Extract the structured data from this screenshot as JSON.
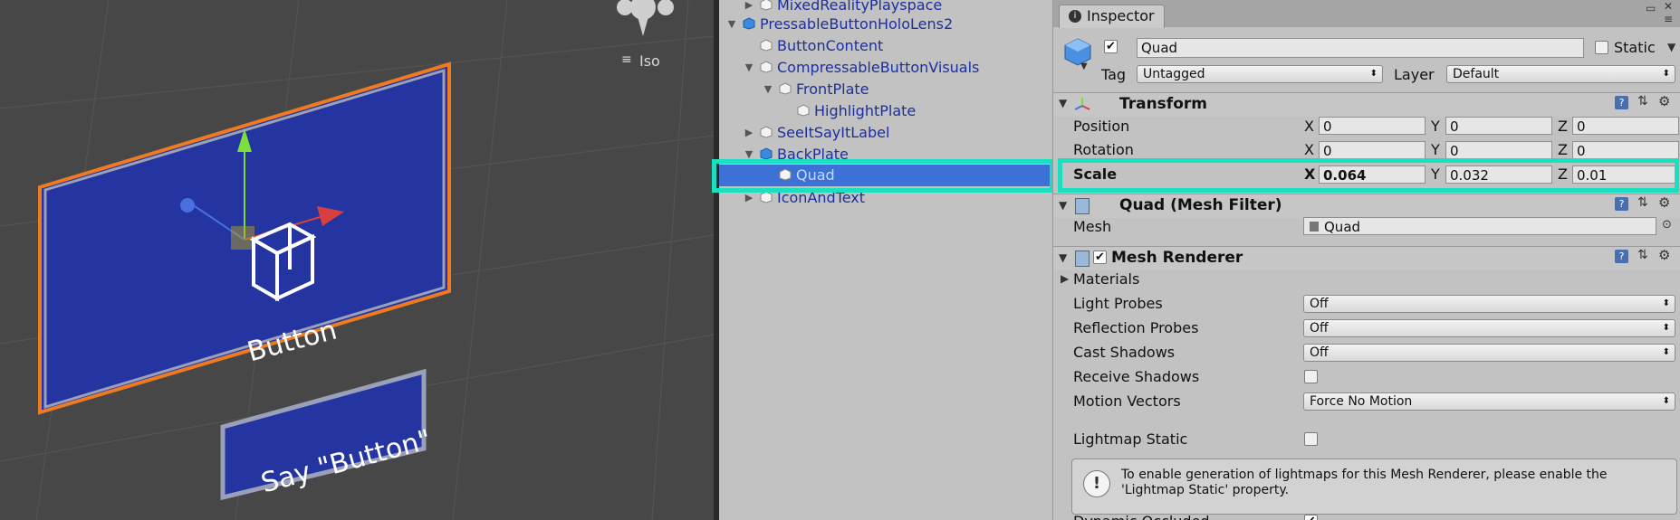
{
  "scene": {
    "projection_label": "Iso",
    "button_label": "Button",
    "say_label": "Say \"Button\""
  },
  "hierarchy": {
    "items": [
      {
        "label": "MixedRealityPlayspace",
        "expanded": false,
        "has_children": true
      },
      {
        "label": "PressableButtonHoloLens2",
        "expanded": true,
        "has_children": true
      },
      {
        "label": "ButtonContent",
        "has_children": false
      },
      {
        "label": "CompressableButtonVisuals",
        "expanded": true,
        "has_children": true
      },
      {
        "label": "FrontPlate",
        "expanded": true,
        "has_children": true
      },
      {
        "label": "HighlightPlate",
        "has_children": false
      },
      {
        "label": "SeeItSayItLabel",
        "expanded": false,
        "has_children": true
      },
      {
        "label": "BackPlate",
        "expanded": true,
        "has_children": true
      },
      {
        "label": "Quad",
        "selected": true,
        "has_children": false
      },
      {
        "label": "IconAndText",
        "expanded": false,
        "has_children": true
      }
    ]
  },
  "inspector": {
    "tab_label": "Inspector",
    "object_name": "Quad",
    "static_label": "Static",
    "tag_label": "Tag",
    "tag_value": "Untagged",
    "layer_label": "Layer",
    "layer_value": "Default",
    "transform": {
      "title": "Transform",
      "position": {
        "label": "Position",
        "x": "0",
        "y": "0",
        "z": "0"
      },
      "rotation": {
        "label": "Rotation",
        "x": "0",
        "y": "0",
        "z": "0"
      },
      "scale": {
        "label": "Scale",
        "x": "0.064",
        "y": "0.032",
        "z": "0.01"
      },
      "axis_x": "X",
      "axis_y": "Y",
      "axis_z": "Z"
    },
    "mesh_filter": {
      "title": "Quad (Mesh Filter)",
      "mesh_label": "Mesh",
      "mesh_value": "Quad"
    },
    "mesh_renderer": {
      "title": "Mesh Renderer",
      "materials_label": "Materials",
      "light_probes_label": "Light Probes",
      "light_probes_value": "Off",
      "reflection_probes_label": "Reflection Probes",
      "reflection_probes_value": "Off",
      "cast_shadows_label": "Cast Shadows",
      "cast_shadows_value": "Off",
      "receive_shadows_label": "Receive Shadows",
      "motion_vectors_label": "Motion Vectors",
      "motion_vectors_value": "Force No Motion",
      "lightmap_static_label": "Lightmap Static",
      "help_text": "To enable generation of lightmaps for this Mesh Renderer, please enable the 'Lightmap Static' property.",
      "dynamic_occluded_label": "Dynamic Occluded"
    }
  },
  "colors": {
    "scene_bg": "#474747",
    "plate_blue": "#2434a0",
    "selection_orange": "#f07a20",
    "highlight_teal": "#19e0c0",
    "hierarchy_selected": "#3d71d6"
  }
}
